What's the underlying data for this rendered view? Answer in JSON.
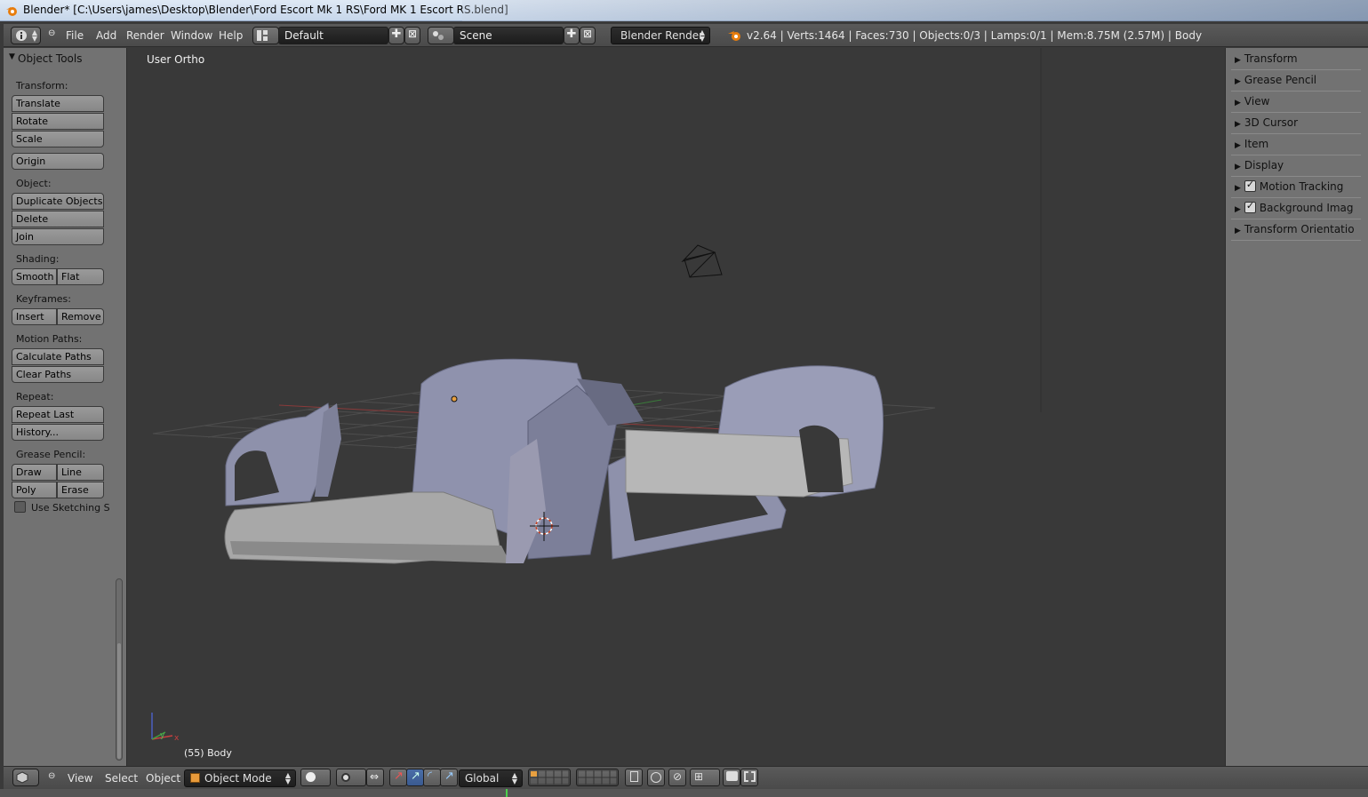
{
  "window": {
    "title": "Blender* [C:\\Users\\james\\Desktop\\Blender\\Ford Escort Mk 1 RS\\Ford MK 1 Escort RS.blend]"
  },
  "topbar": {
    "menus": [
      "File",
      "Add",
      "Render",
      "Window",
      "Help"
    ],
    "screen_layout": "Default",
    "scene": "Scene",
    "render_engine": "Blender Render",
    "stats": "v2.64 | Verts:1464 | Faces:730 | Objects:0/3 | Lamps:0/1 | Mem:8.75M (2.57M) | Body"
  },
  "tool_shelf": {
    "title": "Object Tools",
    "transform_label": "Transform:",
    "translate": "Translate",
    "rotate": "Rotate",
    "scale": "Scale",
    "origin": "Origin",
    "object_label": "Object:",
    "duplicate": "Duplicate Objects",
    "delete": "Delete",
    "join": "Join",
    "shading_label": "Shading:",
    "smooth": "Smooth",
    "flat": "Flat",
    "keyframes_label": "Keyframes:",
    "insert": "Insert",
    "remove": "Remove",
    "motion_paths_label": "Motion Paths:",
    "calculate_paths": "Calculate Paths",
    "clear_paths": "Clear Paths",
    "repeat_label": "Repeat:",
    "repeat_last": "Repeat Last",
    "history": "History...",
    "grease_pencil_label": "Grease Pencil:",
    "draw": "Draw",
    "line": "Line",
    "poly": "Poly",
    "erase": "Erase",
    "use_sketching": "Use Sketching S"
  },
  "viewport": {
    "view_name": "User Ortho",
    "object_info": "(55) Body",
    "axis_y": "y",
    "axis_x": "x"
  },
  "properties_panel": {
    "items": [
      {
        "label": "Transform"
      },
      {
        "label": "Grease Pencil"
      },
      {
        "label": "View"
      },
      {
        "label": "3D Cursor"
      },
      {
        "label": "Item"
      },
      {
        "label": "Display"
      },
      {
        "label": "Motion Tracking"
      },
      {
        "label": "Background Imag"
      },
      {
        "label": "Transform Orientatio"
      }
    ]
  },
  "bottombar": {
    "menus": [
      "View",
      "Select",
      "Object"
    ],
    "mode": "Object Mode",
    "orientation": "Global"
  },
  "colors": {
    "header": "#4f4f4f",
    "panel": "#727272",
    "viewport": "#393939",
    "mesh": "#9a9db5"
  }
}
